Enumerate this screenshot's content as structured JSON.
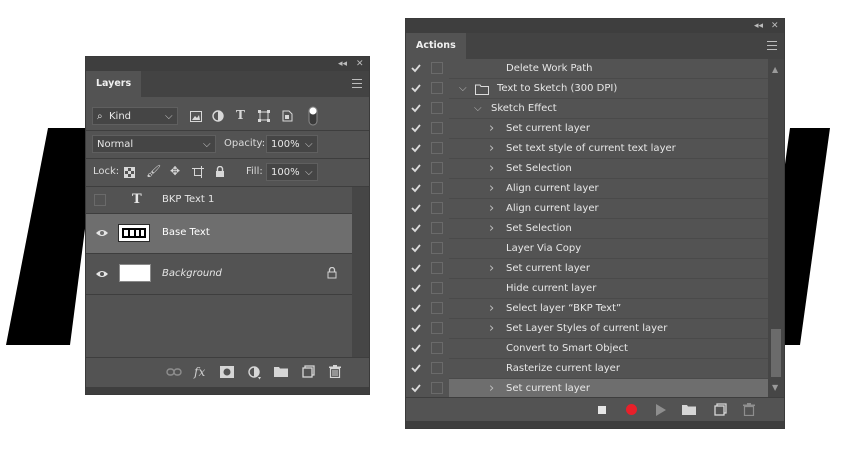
{
  "layers_panel": {
    "title": "Layers",
    "filter": {
      "label": "Kind"
    },
    "blend_mode": "Normal",
    "opacity": {
      "label": "Opacity:",
      "value": "100%"
    },
    "lock_label": "Lock:",
    "fill": {
      "label": "Fill:",
      "value": "100%"
    },
    "layers": [
      {
        "name": "BKP Text 1",
        "kind": "text",
        "visible": false,
        "selected": false
      },
      {
        "name": "Base Text",
        "kind": "smart",
        "visible": true,
        "selected": true
      },
      {
        "name": "Background",
        "kind": "background",
        "visible": true,
        "selected": false,
        "locked": true
      }
    ],
    "footer_icons": [
      "link-icon",
      "fx-icon",
      "mask-icon",
      "adjustment-icon",
      "folder-icon",
      "new-layer-icon",
      "trash-icon"
    ],
    "fx_label": "fx"
  },
  "actions_panel": {
    "title": "Actions",
    "items": [
      {
        "label": "Delete Work Path",
        "indent": 2,
        "caret": "none"
      },
      {
        "label": "Text to Sketch (300 DPI)",
        "indent": 0,
        "caret": "open",
        "folder": true
      },
      {
        "label": "Sketch Effect",
        "indent": 1,
        "caret": "open"
      },
      {
        "label": "Set current layer",
        "indent": 2,
        "caret": "closed"
      },
      {
        "label": "Set text style of current text layer",
        "indent": 2,
        "caret": "closed"
      },
      {
        "label": "Set Selection",
        "indent": 2,
        "caret": "closed"
      },
      {
        "label": "Align current layer",
        "indent": 2,
        "caret": "closed"
      },
      {
        "label": "Align current layer",
        "indent": 2,
        "caret": "closed"
      },
      {
        "label": "Set Selection",
        "indent": 2,
        "caret": "closed"
      },
      {
        "label": "Layer Via Copy",
        "indent": 2,
        "caret": "none"
      },
      {
        "label": "Set current layer",
        "indent": 2,
        "caret": "closed"
      },
      {
        "label": "Hide current layer",
        "indent": 2,
        "caret": "none"
      },
      {
        "label": "Select layer “BKP Text”",
        "indent": 2,
        "caret": "closed"
      },
      {
        "label": "Set Layer Styles of current layer",
        "indent": 2,
        "caret": "closed"
      },
      {
        "label": "Convert to Smart Object",
        "indent": 2,
        "caret": "none"
      },
      {
        "label": "Rasterize current layer",
        "indent": 2,
        "caret": "none"
      },
      {
        "label": "Set current layer",
        "indent": 2,
        "caret": "closed",
        "selected": true
      }
    ],
    "footer_icons": [
      "stop-icon",
      "record-icon",
      "play-icon",
      "folder-icon",
      "new-action-icon",
      "trash-icon"
    ]
  },
  "colors": {
    "panel": "#535353",
    "selected_row": "#6e6e6e",
    "record": "#e8202a"
  }
}
